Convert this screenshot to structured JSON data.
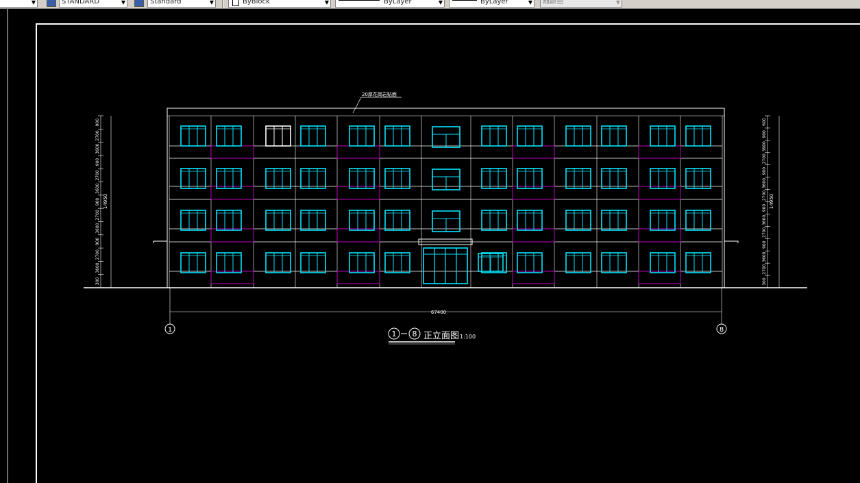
{
  "toolbar": {
    "textstyle": "STANDARD",
    "dimstyle": "Standard",
    "color": "ByBlock",
    "linetype": "ByLayer",
    "lineweight": "ByLayer",
    "plotstyle": "随颜色"
  },
  "drawing": {
    "roof_note": "20厚花岗岩贴面",
    "title": "正立面图",
    "scale": "1:100",
    "axis_start": "1",
    "axis_end": "8",
    "total_dim": "67400",
    "left_total": "14950",
    "right_total": "14950",
    "left_dims": [
      "300",
      "3600",
      "2700",
      "900",
      "3600",
      "2700",
      "900",
      "3600",
      "2700",
      "900",
      "3600",
      "2700",
      "900"
    ],
    "right_dims": [
      "600",
      "900",
      "3900",
      "2700",
      "900",
      "3600",
      "2700",
      "900",
      "3600",
      "2700",
      "900",
      "3600",
      "2700",
      "300"
    ],
    "colors": {
      "frame": "#ffffff",
      "window": "#00e5ff",
      "balcony": "#c000c0"
    }
  }
}
